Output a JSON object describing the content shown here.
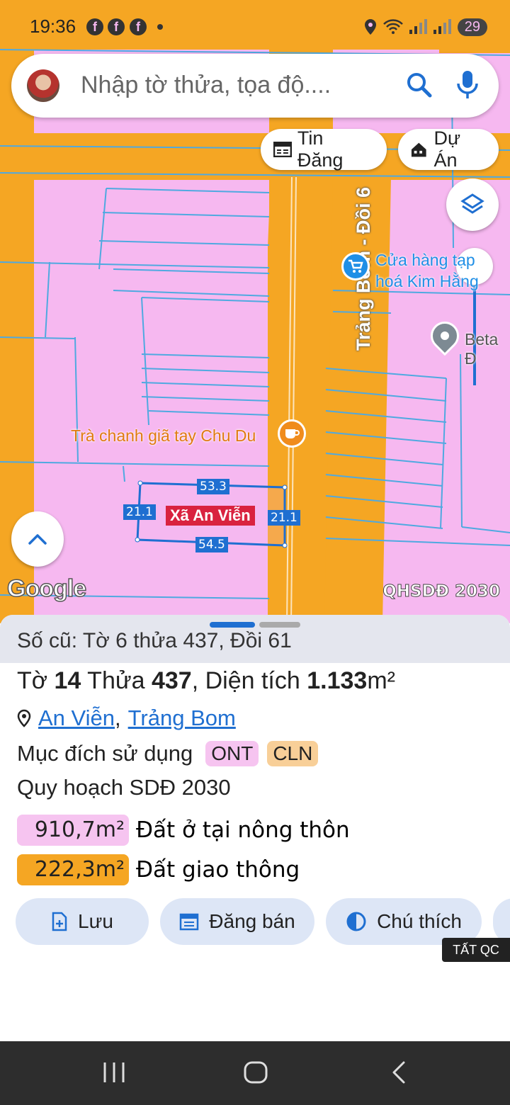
{
  "status": {
    "time": "19:36",
    "battery": "29"
  },
  "search": {
    "placeholder": "Nhập tờ thửa, tọa độ...."
  },
  "chips": {
    "listings": "Tin Đăng",
    "projects": "Dự Án"
  },
  "map": {
    "road_label": "Trảng Bom - Đồi 6",
    "poi_store_line1": "Cửa hàng tạp",
    "poi_store_line2": "hoá Kim Hằng",
    "poi_beta": "Beta Đ",
    "poi_tea": "Trà chanh giã tay Chu Du",
    "parcel_name": "Xã An Viễn",
    "dims": {
      "top": "53.3",
      "bottom": "54.5",
      "left": "21.1",
      "right": "21.1"
    },
    "google": "Google",
    "plan_label": "QHSDĐ 2030"
  },
  "parcel": {
    "old_ref": "Số cũ: Tờ 6 thửa 437, Đồi 61",
    "sheet_prefix": "Tờ ",
    "sheet_no": "14",
    "plot_prefix": " Thửa ",
    "plot_no": "437",
    "area_prefix": ", Diện tích ",
    "area_value": "1.133",
    "area_unit": "m²",
    "commune": "An Viễn",
    "separator": ",",
    "district": "Trảng Bom",
    "purpose_label": "Mục đích sử dụng",
    "tag_ont": "ONT",
    "tag_cln": "CLN",
    "plan_title": "Quy hoạch SDĐ 2030",
    "plan_items": [
      {
        "area": "910,7m²",
        "label": "Đất ở tại nông thôn",
        "color": "#f6c4f0"
      },
      {
        "area": "222,3m²",
        "label": "Đất giao thông",
        "color": "#f5a623"
      }
    ]
  },
  "actions": {
    "save": "Lưu",
    "post": "Đăng bán",
    "legend": "Chú thích"
  },
  "ad": {
    "hide": "TẤT QC"
  },
  "colors": {
    "road": "#f5a623",
    "land": "#f6b8f0",
    "accent": "#1f6fd1",
    "parcel_tag": "#d9223f"
  },
  "icons": [
    "search-icon",
    "mic-icon",
    "newspaper-icon",
    "building-icon",
    "layers-icon",
    "chevron-up-icon",
    "location-pin-icon",
    "file-add-icon",
    "calendar-icon",
    "contrast-icon",
    "recents-icon",
    "home-icon",
    "back-icon"
  ]
}
